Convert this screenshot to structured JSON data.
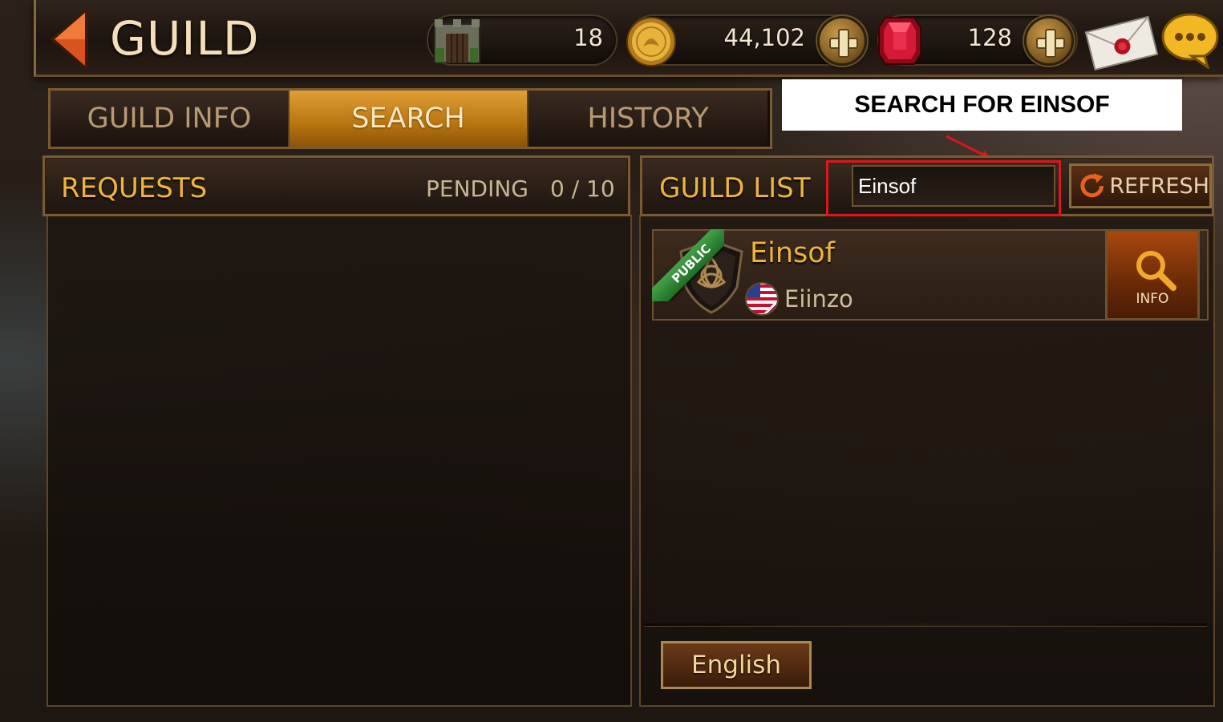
{
  "header": {
    "title": "GUILD",
    "resources": {
      "castle_count": "18",
      "gold": "44,102",
      "gems": "128"
    }
  },
  "tabs": [
    {
      "label": "GUILD INFO",
      "active": false
    },
    {
      "label": "SEARCH",
      "active": true
    },
    {
      "label": "HISTORY",
      "active": false
    }
  ],
  "annotation": {
    "text": "SEARCH FOR EINSOF"
  },
  "requests": {
    "title": "REQUESTS",
    "pending_label": "PENDING",
    "pending_count": "0 / 10"
  },
  "guild_list": {
    "title": "GUILD LIST",
    "search_value": "Einsof",
    "refresh_label": "REFRESH",
    "results": [
      {
        "badge": "PUBLIC",
        "name": "Einsof",
        "leader": "Eiinzo",
        "info_label": "INFO"
      }
    ],
    "language_button": "English"
  },
  "colors": {
    "accent_gold": "#f0b43a",
    "active_tab": "#c8861b",
    "annotation_red": "#e0141c",
    "public_green": "#2f8a36"
  },
  "icons": [
    "back-arrow-icon",
    "castle-icon",
    "gold-coin-icon",
    "plus-icon",
    "ruby-gem-icon",
    "mail-icon",
    "chat-icon",
    "refresh-icon",
    "guild-emblem-icon",
    "flag-icon",
    "magnifier-icon"
  ]
}
